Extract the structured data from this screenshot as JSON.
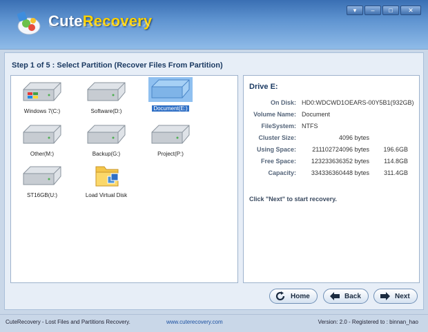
{
  "app": {
    "logo_name": "Cute",
    "logo_accent": "Recovery",
    "window_buttons": [
      "▾",
      "‒",
      "□",
      "✕"
    ]
  },
  "main": {
    "step_title": "Step 1 of 5 : Select Partition (Recover Files From Partition)",
    "partitions": [
      {
        "label": "Windows 7(C:)",
        "icon": "windows-drive-icon",
        "selected": false
      },
      {
        "label": "Software(D:)",
        "icon": "hard-drive-icon",
        "selected": false
      },
      {
        "label": "Document(E:)",
        "icon": "hard-drive-icon",
        "selected": true
      },
      {
        "label": "Other(M:)",
        "icon": "hard-drive-icon",
        "selected": false
      },
      {
        "label": "Backup(G:)",
        "icon": "hard-drive-icon",
        "selected": false
      },
      {
        "label": "Project(P:)",
        "icon": "hard-drive-icon",
        "selected": false
      },
      {
        "label": "ST16GB(U:)",
        "icon": "hard-drive-icon",
        "selected": false
      },
      {
        "label": "Load Virtual Disk",
        "icon": "folder-disk-icon",
        "selected": false
      }
    ],
    "info": {
      "drive_title": "Drive E:",
      "on_disk_label": "On Disk:",
      "on_disk_value": "HD0:WDCWD1OEARS-00Y5B1(932GB)",
      "volume_name_label": "Volume Name:",
      "volume_name_value": "Document",
      "filesystem_label": "FileSystem:",
      "filesystem_value": "NTFS",
      "cluster_size_label": "Cluster Size:",
      "cluster_size_value": "4096 bytes",
      "using_space_label": "Using Space:",
      "using_space_bytes": "211102724096 bytes",
      "using_space_gb": "196.6GB",
      "free_space_label": "Free Space:",
      "free_space_bytes": "123233636352 bytes",
      "free_space_gb": "114.8GB",
      "capacity_label": "Capacity:",
      "capacity_bytes": "334336360448 bytes",
      "capacity_gb": "311.4GB",
      "hint": "Click \"Next\" to start recovery."
    },
    "buttons": {
      "home": "Home",
      "back": "Back",
      "next": "Next"
    }
  },
  "footer": {
    "product": "CuteRecovery - Lost Files and Partitions Recovery.",
    "website": "www.cuterecovery.com",
    "version": "Version: 2.0 - Registered to : binnan_hao"
  },
  "colors": {
    "header_blue": "#3a6fb3",
    "selection_blue": "#2f6fc5",
    "logo_accent": "#ffd200"
  }
}
